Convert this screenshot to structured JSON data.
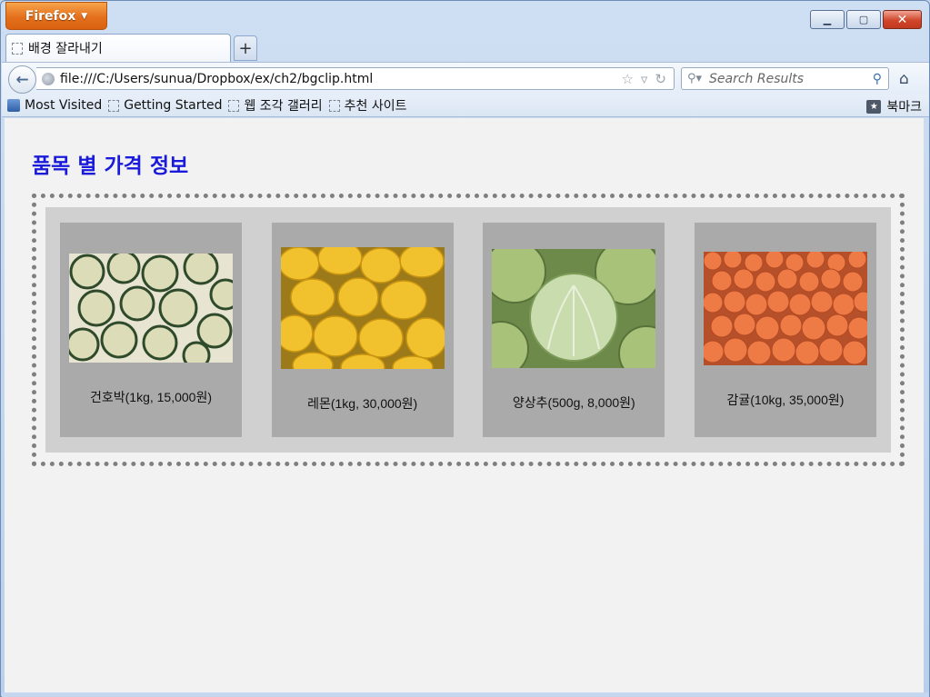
{
  "browser": {
    "app_button": "Firefox",
    "tab_title": "배경 잘라내기",
    "url": "file:///C:/Users/sunua/Dropbox/ex/ch2/bgclip.html",
    "search_placeholder": "Search Results",
    "bookmarks": [
      "Most Visited",
      "Getting Started",
      "웹 조각 갤러리",
      "추천 사이트"
    ],
    "bookmarks_menu": "북마크"
  },
  "page": {
    "heading": "품목 별 가격 정보",
    "heading_color": "#1a1adb",
    "items": [
      {
        "caption": "건호박(1kg, 15,000원)",
        "image": "dried-zucchini-photo"
      },
      {
        "caption": "레몬(1kg, 30,000원)",
        "image": "lemons-photo"
      },
      {
        "caption": "양상추(500g, 8,000원)",
        "image": "cabbage-photo"
      },
      {
        "caption": "감귤(10kg, 35,000원)",
        "image": "tangerines-photo"
      }
    ]
  }
}
